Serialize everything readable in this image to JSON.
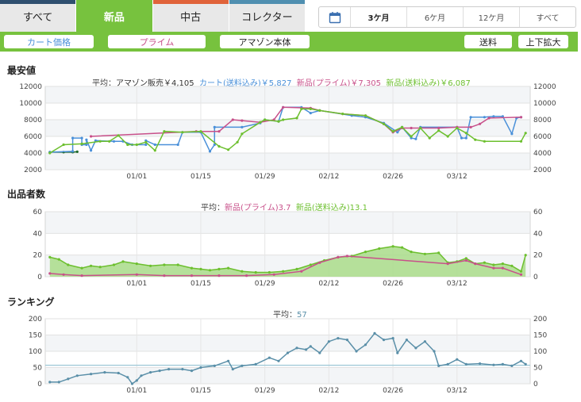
{
  "tabs": [
    {
      "label": "すべて",
      "stripe": "#2f4f6f",
      "active": false
    },
    {
      "label": "新品",
      "stripe": "#77c23e",
      "active": true
    },
    {
      "label": "中古",
      "stripe": "#e0633a",
      "active": false
    },
    {
      "label": "コレクター",
      "stripe": "#4f8fb0",
      "active": false
    }
  ],
  "period": {
    "icon": "calendar-icon",
    "options": [
      "3ケ月",
      "6ケ月",
      "12ケ月",
      "すべて"
    ],
    "selected": "3ケ月"
  },
  "filters": {
    "cart": "カート価格",
    "prime": "プライム",
    "amazon": "アマゾン本体",
    "shipping": "送料",
    "zoom": "上下拡大"
  },
  "colors": {
    "cart": "#4a90d9",
    "prime": "#c8508a",
    "shipping": "#6cbf2e",
    "amazon": "#1f6a2a",
    "ranking": "#5a8fa8",
    "accent": "#77c23e"
  },
  "sections": {
    "price": {
      "title": "最安値",
      "avg_prefix": "平均：",
      "amazon": "アマゾン販売￥4,105",
      "cart": "カート(送料込み)￥5,827",
      "prime": "新品(プライム)￥7,305",
      "ship": "新品(送料込み)￥6,087"
    },
    "sellers": {
      "title": "出品者数",
      "avg_prefix": "平均：",
      "prime": "新品(プライム)3.7",
      "ship": "新品(送料込み)13.1"
    },
    "ranking": {
      "title": "ランキング",
      "avg_prefix": "平均：",
      "value": "57"
    }
  },
  "x_ticks": [
    "01/01",
    "01/15",
    "01/29",
    "02/12",
    "02/26",
    "03/12"
  ],
  "chart_data": [
    {
      "type": "line",
      "title": "最安値",
      "ylim": [
        2000,
        12000
      ],
      "y_ticks": [
        2000,
        4000,
        6000,
        8000,
        10000,
        12000
      ],
      "grid": true,
      "x_range_days": [
        -20,
        75
      ],
      "series": [
        {
          "name": "アマゾン販売",
          "color_key": "amazon",
          "points": [
            [
              -19,
              4100
            ],
            [
              -16,
              4100
            ],
            [
              -14,
              4100
            ],
            [
              -13,
              4150
            ]
          ]
        },
        {
          "name": "カート(送料込み)",
          "color_key": "cart",
          "points": [
            [
              -19,
              4100
            ],
            [
              -14,
              4200
            ],
            [
              -14,
              5800
            ],
            [
              -12,
              5800
            ],
            [
              -12,
              5000
            ],
            [
              -11,
              5000
            ],
            [
              -11,
              5600
            ],
            [
              -10,
              4300
            ],
            [
              -9,
              5500
            ],
            [
              -5,
              5400
            ],
            [
              -3,
              5400
            ],
            [
              -1,
              5000
            ],
            [
              2,
              5000
            ],
            [
              2,
              5500
            ],
            [
              4,
              5000
            ],
            [
              9,
              5000
            ],
            [
              10,
              6500
            ],
            [
              14,
              6500
            ],
            [
              16,
              4200
            ],
            [
              17,
              5000
            ],
            [
              17,
              7100
            ],
            [
              23,
              7100
            ],
            [
              27,
              7600
            ],
            [
              28,
              8000
            ],
            [
              31,
              7800
            ],
            [
              32,
              9500
            ],
            [
              36,
              9500
            ],
            [
              38,
              8800
            ],
            [
              40,
              9100
            ],
            [
              47,
              8500
            ],
            [
              50,
              8300
            ],
            [
              54,
              7600
            ],
            [
              57,
              6500
            ],
            [
              58,
              7100
            ],
            [
              60,
              5800
            ],
            [
              61,
              5700
            ],
            [
              62,
              7100
            ],
            [
              70,
              7100
            ],
            [
              71,
              5800
            ],
            [
              72,
              5800
            ],
            [
              73,
              8300
            ],
            [
              76,
              8300
            ],
            [
              78,
              8400
            ],
            [
              80,
              8400
            ],
            [
              82,
              6300
            ],
            [
              83,
              8200
            ],
            [
              84,
              8300
            ]
          ]
        },
        {
          "name": "新品(プライム)",
          "color_key": "prime",
          "points": [
            [
              -10,
              6000
            ],
            [
              13,
              6600
            ],
            [
              18,
              6600
            ],
            [
              21,
              8000
            ],
            [
              23,
              7900
            ],
            [
              27,
              7700
            ],
            [
              30,
              8000
            ],
            [
              32,
              9500
            ],
            [
              38,
              9400
            ],
            [
              40,
              9100
            ],
            [
              45,
              8700
            ],
            [
              50,
              8500
            ],
            [
              54,
              7500
            ],
            [
              56,
              6500
            ],
            [
              58,
              7000
            ],
            [
              60,
              7000
            ],
            [
              66,
              7000
            ],
            [
              70,
              7100
            ],
            [
              73,
              7100
            ],
            [
              75,
              7500
            ],
            [
              77,
              8200
            ],
            [
              84,
              8300
            ]
          ]
        },
        {
          "name": "新品(送料込み)",
          "color_key": "shipping",
          "points": [
            [
              -19,
              4000
            ],
            [
              -16,
              5000
            ],
            [
              -12,
              5100
            ],
            [
              -8,
              5400
            ],
            [
              -6,
              5400
            ],
            [
              -4,
              6100
            ],
            [
              -2,
              5000
            ],
            [
              0,
              5000
            ],
            [
              2,
              5300
            ],
            [
              4,
              4300
            ],
            [
              6,
              6600
            ],
            [
              10,
              6500
            ],
            [
              14,
              6600
            ],
            [
              18,
              4800
            ],
            [
              20,
              4400
            ],
            [
              22,
              5300
            ],
            [
              23,
              6300
            ],
            [
              27,
              7700
            ],
            [
              28,
              8000
            ],
            [
              31,
              7800
            ],
            [
              32,
              8000
            ],
            [
              35,
              8200
            ],
            [
              36,
              9300
            ],
            [
              38,
              9300
            ],
            [
              40,
              9100
            ],
            [
              45,
              8700
            ],
            [
              50,
              8500
            ],
            [
              54,
              7500
            ],
            [
              56,
              6600
            ],
            [
              58,
              7100
            ],
            [
              60,
              6000
            ],
            [
              62,
              7000
            ],
            [
              64,
              5800
            ],
            [
              66,
              6700
            ],
            [
              68,
              6000
            ],
            [
              70,
              7000
            ],
            [
              72,
              6400
            ],
            [
              74,
              5600
            ],
            [
              76,
              5400
            ],
            [
              84,
              5400
            ],
            [
              85,
              6400
            ]
          ]
        }
      ]
    },
    {
      "type": "area",
      "title": "出品者数",
      "ylim": [
        0,
        60
      ],
      "y_ticks": [
        0,
        20,
        40,
        60
      ],
      "grid": true,
      "series": [
        {
          "name": "新品(送料込み)",
          "color_key": "shipping",
          "points": [
            [
              -19,
              18
            ],
            [
              -17,
              16
            ],
            [
              -15,
              11
            ],
            [
              -12,
              8
            ],
            [
              -10,
              10
            ],
            [
              -8,
              9
            ],
            [
              -5,
              11
            ],
            [
              -3,
              14
            ],
            [
              0,
              12
            ],
            [
              3,
              10
            ],
            [
              6,
              11
            ],
            [
              9,
              11
            ],
            [
              12,
              8
            ],
            [
              14,
              7
            ],
            [
              16,
              6
            ],
            [
              18,
              7
            ],
            [
              20,
              8
            ],
            [
              23,
              5
            ],
            [
              26,
              4
            ],
            [
              29,
              4
            ],
            [
              32,
              5
            ],
            [
              35,
              7
            ],
            [
              38,
              11
            ],
            [
              41,
              15
            ],
            [
              44,
              18
            ],
            [
              47,
              19
            ],
            [
              50,
              23
            ],
            [
              53,
              26
            ],
            [
              56,
              28
            ],
            [
              58,
              27
            ],
            [
              60,
              23
            ],
            [
              63,
              21
            ],
            [
              66,
              22
            ],
            [
              68,
              13
            ],
            [
              70,
              14
            ],
            [
              72,
              17
            ],
            [
              74,
              12
            ],
            [
              76,
              13
            ],
            [
              78,
              11
            ],
            [
              80,
              12
            ],
            [
              82,
              10
            ],
            [
              84,
              5
            ],
            [
              85,
              20
            ]
          ]
        },
        {
          "name": "新品(プライム)",
          "color_key": "prime",
          "points": [
            [
              -19,
              3
            ],
            [
              -16,
              2
            ],
            [
              -12,
              1
            ],
            [
              0,
              2
            ],
            [
              6,
              1
            ],
            [
              12,
              1
            ],
            [
              18,
              1
            ],
            [
              24,
              1
            ],
            [
              30,
              2
            ],
            [
              36,
              5
            ],
            [
              40,
              13
            ],
            [
              44,
              18
            ],
            [
              46,
              19
            ],
            [
              68,
              12
            ],
            [
              72,
              15
            ],
            [
              74,
              12
            ],
            [
              78,
              8
            ],
            [
              80,
              8
            ],
            [
              84,
              2
            ]
          ]
        }
      ]
    },
    {
      "type": "line",
      "title": "ランキング",
      "ylim": [
        0,
        200
      ],
      "y_ticks": [
        0,
        50,
        100,
        150,
        200
      ],
      "grid": true,
      "average_line": 57,
      "series": [
        {
          "name": "ランキング",
          "color_key": "ranking",
          "points": [
            [
              -19,
              5
            ],
            [
              -17,
              5
            ],
            [
              -15,
              15
            ],
            [
              -13,
              25
            ],
            [
              -10,
              30
            ],
            [
              -7,
              35
            ],
            [
              -4,
              33
            ],
            [
              -2,
              20
            ],
            [
              -1,
              0
            ],
            [
              0,
              10
            ],
            [
              1,
              25
            ],
            [
              3,
              35
            ],
            [
              5,
              40
            ],
            [
              7,
              45
            ],
            [
              10,
              45
            ],
            [
              12,
              40
            ],
            [
              14,
              50
            ],
            [
              17,
              55
            ],
            [
              20,
              70
            ],
            [
              21,
              45
            ],
            [
              23,
              55
            ],
            [
              26,
              60
            ],
            [
              29,
              80
            ],
            [
              31,
              70
            ],
            [
              33,
              95
            ],
            [
              35,
              110
            ],
            [
              37,
              105
            ],
            [
              38,
              115
            ],
            [
              40,
              95
            ],
            [
              42,
              130
            ],
            [
              44,
              140
            ],
            [
              46,
              135
            ],
            [
              48,
              100
            ],
            [
              50,
              120
            ],
            [
              52,
              155
            ],
            [
              54,
              135
            ],
            [
              56,
              140
            ],
            [
              57,
              95
            ],
            [
              59,
              135
            ],
            [
              61,
              110
            ],
            [
              63,
              130
            ],
            [
              65,
              100
            ],
            [
              66,
              55
            ],
            [
              68,
              60
            ],
            [
              70,
              75
            ],
            [
              72,
              60
            ],
            [
              75,
              62
            ],
            [
              78,
              58
            ],
            [
              80,
              60
            ],
            [
              82,
              55
            ],
            [
              84,
              70
            ],
            [
              85,
              60
            ]
          ]
        }
      ]
    }
  ]
}
